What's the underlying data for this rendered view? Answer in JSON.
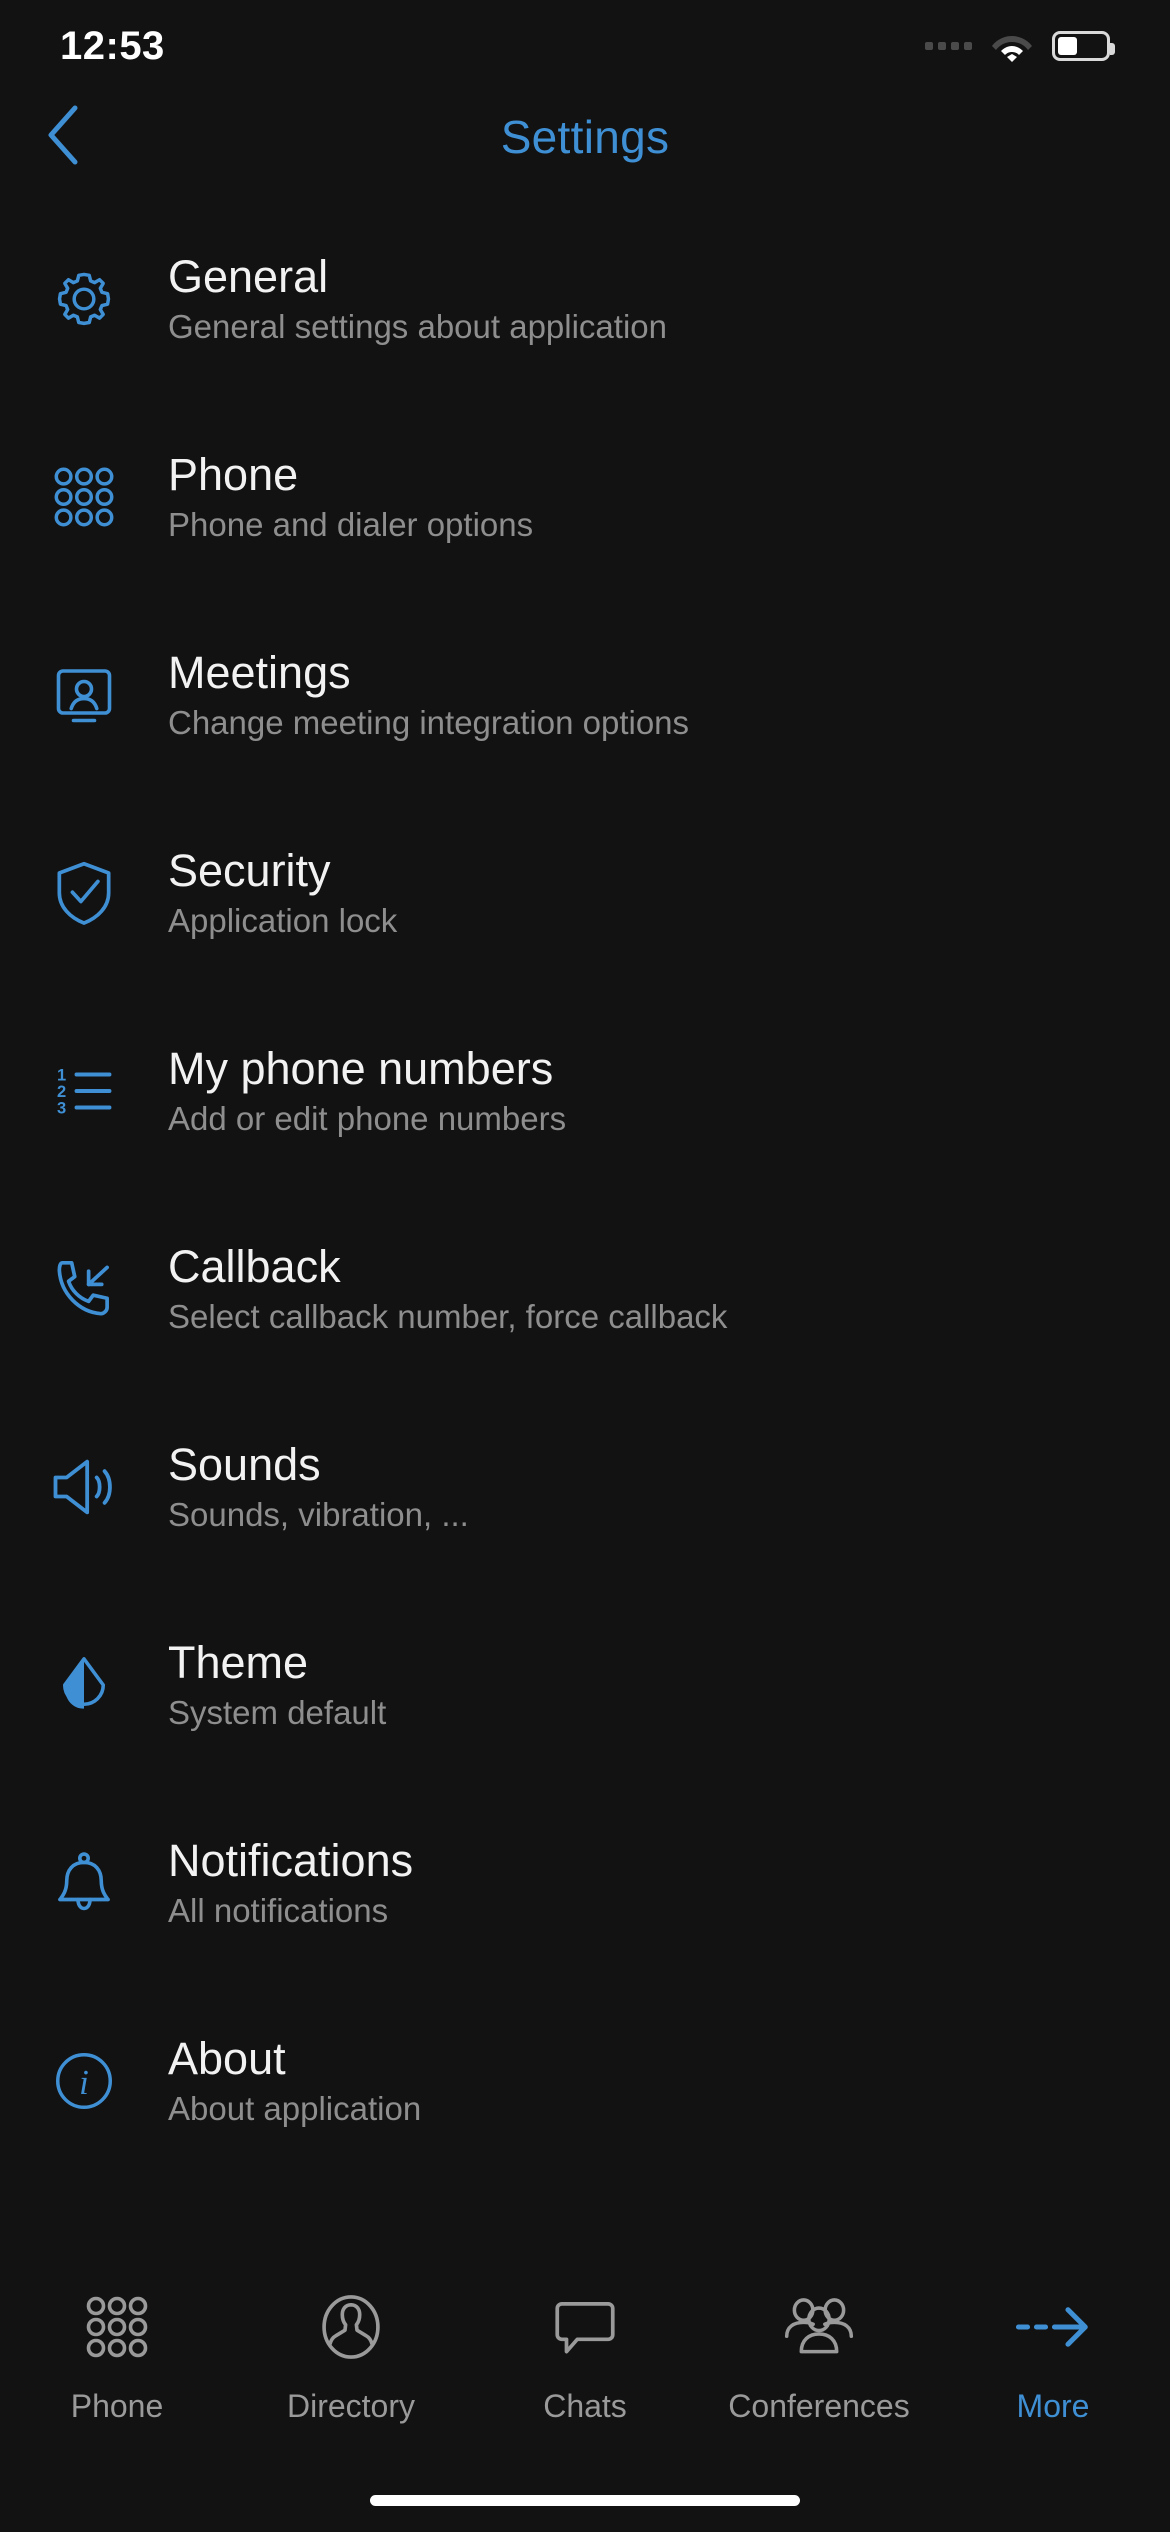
{
  "status_bar": {
    "time": "12:53",
    "signal_icon": "signal-dots-icon",
    "wifi_icon": "wifi-icon",
    "battery_icon": "battery-icon",
    "battery_level_percent": 42
  },
  "header": {
    "back_icon": "chevron-left-icon",
    "title": "Settings",
    "accent_color": "#3f8fd4"
  },
  "settings": {
    "items": [
      {
        "icon": "gear-icon",
        "title": "General",
        "subtitle": "General settings about application"
      },
      {
        "icon": "dialpad-icon",
        "title": "Phone",
        "subtitle": "Phone and dialer options"
      },
      {
        "icon": "meeting-screen-icon",
        "title": "Meetings",
        "subtitle": "Change meeting integration options"
      },
      {
        "icon": "shield-check-icon",
        "title": "Security",
        "subtitle": "Application lock"
      },
      {
        "icon": "numbered-list-icon",
        "title": "My phone numbers",
        "subtitle": "Add or edit phone numbers"
      },
      {
        "icon": "phone-incoming-icon",
        "title": "Callback",
        "subtitle": "Select callback number, force callback"
      },
      {
        "icon": "speaker-icon",
        "title": "Sounds",
        "subtitle": "Sounds, vibration, ..."
      },
      {
        "icon": "theme-drop-icon",
        "title": "Theme",
        "subtitle": "System default"
      },
      {
        "icon": "bell-icon",
        "title": "Notifications",
        "subtitle": "All notifications"
      },
      {
        "icon": "info-circle-icon",
        "title": "About",
        "subtitle": "About application"
      }
    ]
  },
  "tab_bar": {
    "items": [
      {
        "icon": "dialpad-icon",
        "label": "Phone",
        "active": false
      },
      {
        "icon": "person-circle-icon",
        "label": "Directory",
        "active": false
      },
      {
        "icon": "chat-bubble-icon",
        "label": "Chats",
        "active": false
      },
      {
        "icon": "people-group-icon",
        "label": "Conferences",
        "active": false
      },
      {
        "icon": "arrow-right-icon",
        "label": "More",
        "active": true
      }
    ],
    "inactive_color": "#9a9a9a",
    "active_color": "#3f8fd4"
  },
  "colors": {
    "background": "#121212",
    "accent": "#3f8fd4",
    "title_text": "#f2f2f2",
    "subtitle_text": "#8e8e8e"
  }
}
